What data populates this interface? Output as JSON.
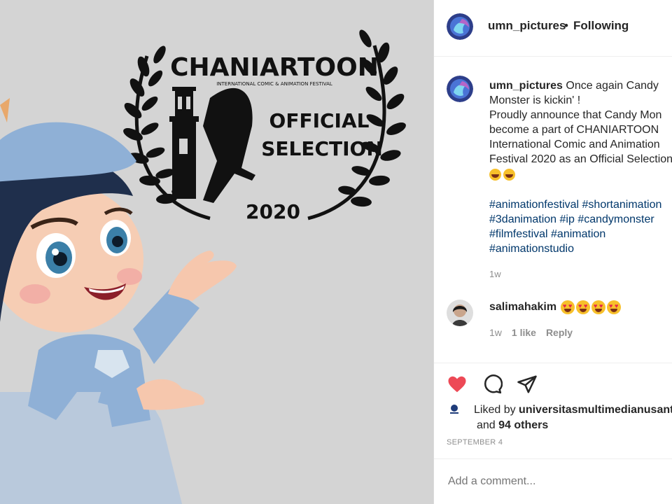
{
  "post_image": {
    "festival_name": "CHANIARTOON",
    "festival_subtitle": "INTERNATIONAL COMIC & ANIMATION FESTIVAL",
    "selection_line1": "OFFICIAL",
    "selection_line2": "SELECTION",
    "year": "2020"
  },
  "header": {
    "username": "umn_pictures",
    "separator": "•",
    "follow_status": "Following"
  },
  "caption": {
    "username": "umn_pictures",
    "line1": " Once again Candy",
    "line2": "Monster is kickin' !",
    "line3": "Proudly announce that Candy Mon",
    "line4": "become a part of CHANIARTOON",
    "line5": "International Comic and Animation",
    "line6": "Festival 2020 as an Official Selection",
    "hashtags_line1": "#animationfestival #shortanimation",
    "hashtags_line2": "#3danimation #ip #candymonster",
    "hashtags_line3": "#filmfestival #animation",
    "hashtags_line4": "#animationstudio",
    "timestamp": "1w"
  },
  "comment": {
    "username": "salimahakim",
    "timestamp": "1w",
    "likes": "1 like",
    "reply": "Reply"
  },
  "likes": {
    "prefix": "Liked by ",
    "liker": "universitasmultimedianusant",
    "and": "and ",
    "others": "94 others"
  },
  "date": "SEPTEMBER 4",
  "add_comment_placeholder": "Add a comment...",
  "colors": {
    "like_red": "#ed4956",
    "hashtag_blue": "#00376b",
    "meta_gray": "#8e8e8e",
    "image_bg": "#d4d4d4"
  },
  "icons": [
    "heart-icon",
    "comment-icon",
    "share-icon"
  ]
}
